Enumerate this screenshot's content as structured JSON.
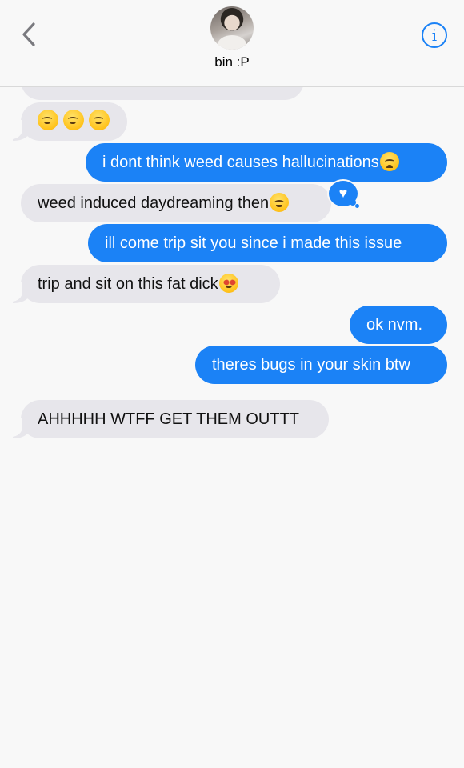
{
  "header": {
    "contact_name": "bin :P",
    "back_icon": "chevron-left-icon",
    "info_icon": "info-icon",
    "info_glyph": "i",
    "accent_color": "#1b82f6"
  },
  "messages": [
    {
      "direction": "incoming",
      "text": "",
      "note": "partially hidden message above"
    },
    {
      "direction": "incoming",
      "text": "",
      "emoji": [
        "smiling-blush-emoji",
        "smiling-blush-emoji",
        "smiling-blush-emoji"
      ]
    },
    {
      "direction": "outgoing",
      "text": "i dont think weed causes hallucinations",
      "emoji": [
        "sad-face-emoji"
      ]
    },
    {
      "direction": "incoming",
      "text": "weed induced daydreaming then",
      "emoji": [
        "woozy-face-emoji"
      ],
      "reaction": "heart"
    },
    {
      "direction": "outgoing",
      "text": "ill come trip sit you since i made this issue"
    },
    {
      "direction": "incoming",
      "text": "trip and sit on this fat dick",
      "emoji": [
        "star-struck-emoji"
      ]
    },
    {
      "direction": "outgoing",
      "text": "ok nvm."
    },
    {
      "direction": "outgoing",
      "text": "theres bugs in your skin btw"
    },
    {
      "direction": "incoming",
      "text": "AHHHHH WTFF GET THEM OUTTT"
    }
  ],
  "reaction": {
    "glyph": "♥",
    "icon": "heart-reaction-icon"
  },
  "colors": {
    "incoming_bubble": "#e7e6eb",
    "outgoing_bubble": "#1b82f6",
    "background": "#f8f8f8"
  }
}
